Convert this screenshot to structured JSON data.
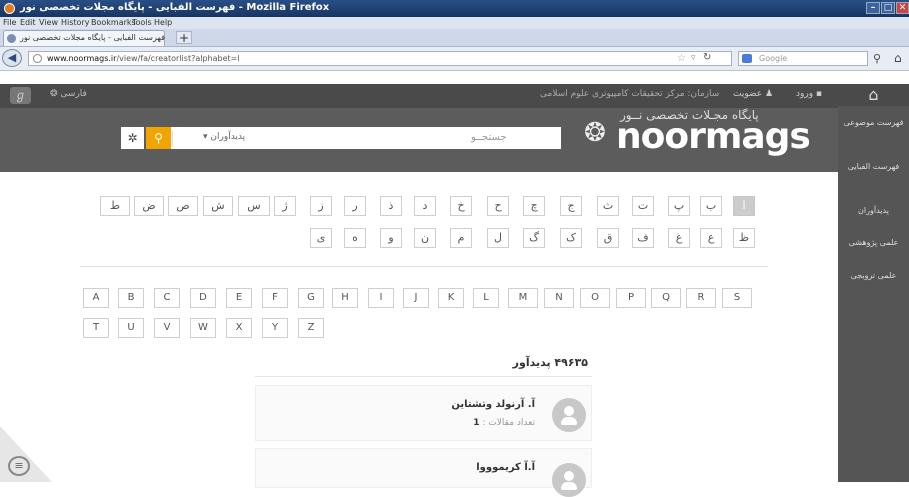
{
  "browser": {
    "window_title": "فهرست الفبایی - پایگاه مجلات تخصصی نور - Mozilla Firefox",
    "menu": [
      "File",
      "Edit",
      "View",
      "History",
      "Bookmarks",
      "Tools",
      "Help"
    ],
    "tab_title": "فهرست الفبایی - پایگاه مجلات تخصصی نور",
    "new_tab": "+",
    "url_host": "www.noormags.ir",
    "url_path": "/view/fa/creatorlist?alphabet=ا",
    "search_engine": "Google"
  },
  "site": {
    "login": "ورود",
    "membership": "عضویت",
    "organization": "سازمان: مرکز تحقیقات کامپیوتری علوم اسلامی",
    "language": "فارسی",
    "logo_fa": "پایگاه مجـلات تخصصی نــور",
    "logo_en": "noormags",
    "search_placeholder": "جستجــو",
    "search_scope": "پدیدآوران"
  },
  "sidebar": {
    "items": [
      "فهرست موضوعی",
      "فهرست الفبایی",
      "پدیدآوران",
      "علمی پژوهشی",
      "علمی ترویجی"
    ]
  },
  "alphabet": {
    "persian_row1": [
      "ا",
      "ب",
      "پ",
      "ت",
      "ث",
      "ج",
      "چ",
      "ح",
      "خ",
      "د",
      "ذ",
      "ر",
      "ز",
      "ژ",
      "س",
      "ش",
      "ص",
      "ض",
      "ط"
    ],
    "persian_row2": [
      "ظ",
      "ع",
      "غ",
      "ف",
      "ق",
      "ک",
      "گ",
      "ل",
      "م",
      "ن",
      "و",
      "ه",
      "ی"
    ],
    "latin_row1": [
      "A",
      "B",
      "C",
      "D",
      "E",
      "F",
      "G",
      "H",
      "I",
      "J",
      "K",
      "L",
      "M",
      "N",
      "O",
      "P",
      "Q",
      "R",
      "S"
    ],
    "latin_row2": [
      "T",
      "U",
      "V",
      "W",
      "X",
      "Y",
      "Z"
    ],
    "selected": "ا"
  },
  "results": {
    "count_title": "۴۹۶۳۵ پدیدآور",
    "authors": [
      {
        "name": "آ. آرنولد وتشتاین",
        "articles_label": "تعداد مقالات :",
        "articles": "1"
      },
      {
        "name": "آ.آ کریموووا"
      }
    ]
  }
}
